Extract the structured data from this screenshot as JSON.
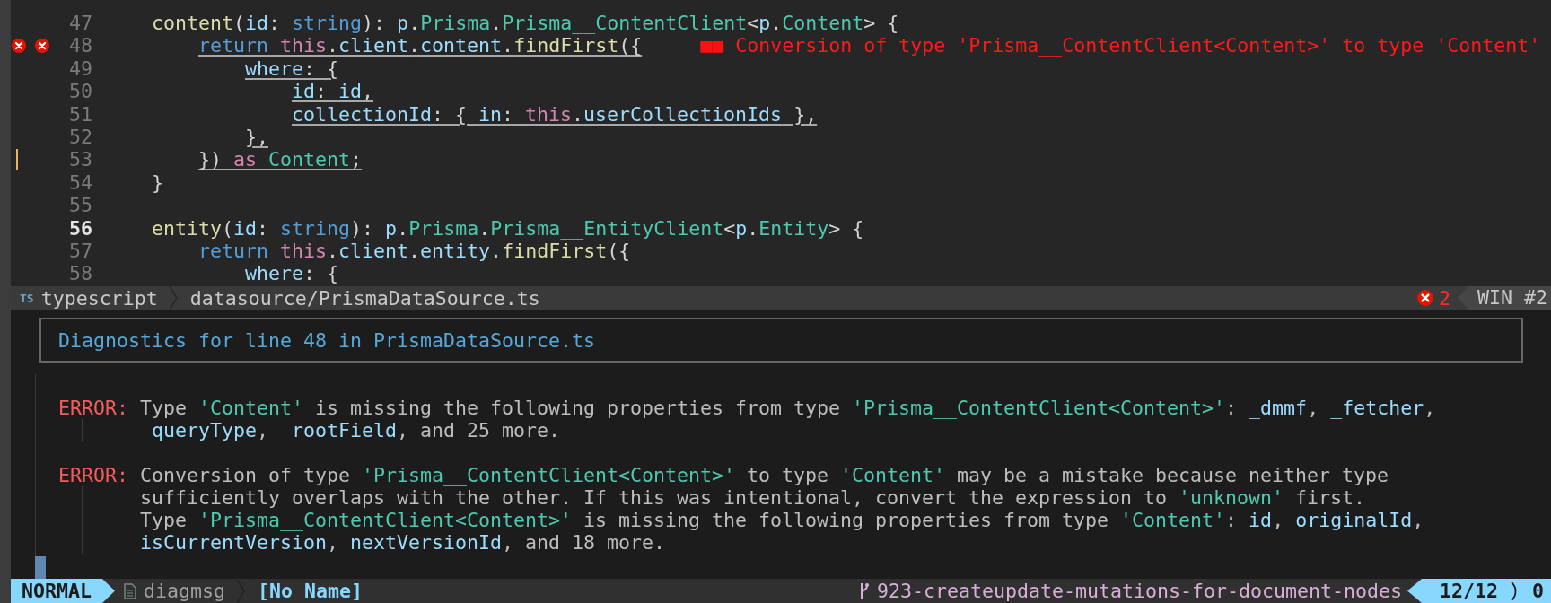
{
  "editor": {
    "lines": [
      {
        "number": "47",
        "current": false,
        "git_change": false,
        "underline": false,
        "tokens": [
          {
            "text": "    content",
            "kind": "function"
          },
          {
            "text": "(",
            "kind": "punctuation"
          },
          {
            "text": "id",
            "kind": "variable"
          },
          {
            "text": ": ",
            "kind": "punctuation"
          },
          {
            "text": "string",
            "kind": "keyword"
          },
          {
            "text": "): ",
            "kind": "punctuation"
          },
          {
            "text": "p",
            "kind": "variable"
          },
          {
            "text": ".",
            "kind": "punctuation"
          },
          {
            "text": "Prisma",
            "kind": "type"
          },
          {
            "text": ".",
            "kind": "punctuation"
          },
          {
            "text": "Prisma__ContentClient",
            "kind": "type"
          },
          {
            "text": "<",
            "kind": "punctuation"
          },
          {
            "text": "p",
            "kind": "variable"
          },
          {
            "text": ".",
            "kind": "punctuation"
          },
          {
            "text": "Content",
            "kind": "type"
          },
          {
            "text": "> {",
            "kind": "punctuation"
          }
        ]
      },
      {
        "number": "48",
        "current": false,
        "git_change": false,
        "underline": true,
        "signs": [
          {
            "kind": "error"
          },
          {
            "kind": "error"
          }
        ],
        "tokens": [
          {
            "text": "        return ",
            "kind": "keyword"
          },
          {
            "text": "this",
            "kind": "control"
          },
          {
            "text": ".",
            "kind": "punctuation"
          },
          {
            "text": "client",
            "kind": "variable"
          },
          {
            "text": ".",
            "kind": "punctuation"
          },
          {
            "text": "content",
            "kind": "variable"
          },
          {
            "text": ".",
            "kind": "punctuation"
          },
          {
            "text": "findFirst",
            "kind": "function"
          },
          {
            "text": "({",
            "kind": "punctuation"
          }
        ],
        "virtual_text": {
          "marker": "■■",
          "text": "Conversion of type 'Prisma__ContentClient<Content>' to type 'Content'"
        }
      },
      {
        "number": "49",
        "current": false,
        "git_change": false,
        "underline": true,
        "tokens": [
          {
            "text": "            where",
            "kind": "variable"
          },
          {
            "text": ": {",
            "kind": "punctuation"
          }
        ]
      },
      {
        "number": "50",
        "current": false,
        "git_change": false,
        "underline": true,
        "tokens": [
          {
            "text": "                id",
            "kind": "variable"
          },
          {
            "text": ": ",
            "kind": "punctuation"
          },
          {
            "text": "id",
            "kind": "variable"
          },
          {
            "text": ",",
            "kind": "punctuation"
          }
        ]
      },
      {
        "number": "51",
        "current": false,
        "git_change": false,
        "underline": true,
        "tokens": [
          {
            "text": "                collectionId",
            "kind": "variable"
          },
          {
            "text": ": { ",
            "kind": "punctuation"
          },
          {
            "text": "in",
            "kind": "variable"
          },
          {
            "text": ": ",
            "kind": "punctuation"
          },
          {
            "text": "this",
            "kind": "control"
          },
          {
            "text": ".",
            "kind": "punctuation"
          },
          {
            "text": "userCollectionIds",
            "kind": "variable"
          },
          {
            "text": " },",
            "kind": "punctuation"
          }
        ]
      },
      {
        "number": "52",
        "current": false,
        "git_change": false,
        "underline": true,
        "tokens": [
          {
            "text": "            },",
            "kind": "punctuation"
          }
        ]
      },
      {
        "number": "53",
        "current": false,
        "git_change": true,
        "underline": true,
        "tokens": [
          {
            "text": "        }) ",
            "kind": "punctuation"
          },
          {
            "text": "as ",
            "kind": "control"
          },
          {
            "text": "Content",
            "kind": "type"
          },
          {
            "text": ";",
            "kind": "punctuation"
          }
        ]
      },
      {
        "number": "54",
        "current": false,
        "git_change": false,
        "underline": false,
        "tokens": [
          {
            "text": "    }",
            "kind": "punctuation"
          }
        ]
      },
      {
        "number": "55",
        "current": false,
        "git_change": false
      },
      {
        "number": "56",
        "current": true,
        "git_change": false,
        "underline": false,
        "tokens": [
          {
            "text": "    entity",
            "kind": "function"
          },
          {
            "text": "(",
            "kind": "punctuation"
          },
          {
            "text": "id",
            "kind": "variable"
          },
          {
            "text": ": ",
            "kind": "punctuation"
          },
          {
            "text": "string",
            "kind": "keyword"
          },
          {
            "text": "): ",
            "kind": "punctuation"
          },
          {
            "text": "p",
            "kind": "variable"
          },
          {
            "text": ".",
            "kind": "punctuation"
          },
          {
            "text": "Prisma",
            "kind": "type"
          },
          {
            "text": ".",
            "kind": "punctuation"
          },
          {
            "text": "Prisma__EntityClient",
            "kind": "type"
          },
          {
            "text": "<",
            "kind": "punctuation"
          },
          {
            "text": "p",
            "kind": "variable"
          },
          {
            "text": ".",
            "kind": "punctuation"
          },
          {
            "text": "Entity",
            "kind": "type"
          },
          {
            "text": "> {",
            "kind": "punctuation"
          }
        ]
      },
      {
        "number": "57",
        "current": false,
        "git_change": false,
        "underline": false,
        "tokens": [
          {
            "text": "        return ",
            "kind": "keyword"
          },
          {
            "text": "this",
            "kind": "control"
          },
          {
            "text": ".",
            "kind": "punctuation"
          },
          {
            "text": "client",
            "kind": "variable"
          },
          {
            "text": ".",
            "kind": "punctuation"
          },
          {
            "text": "entity",
            "kind": "variable"
          },
          {
            "text": ".",
            "kind": "punctuation"
          },
          {
            "text": "findFirst",
            "kind": "function"
          },
          {
            "text": "({",
            "kind": "punctuation"
          }
        ]
      },
      {
        "number": "58",
        "current": false,
        "git_change": false,
        "underline": false,
        "tokens": [
          {
            "text": "            where",
            "kind": "variable"
          },
          {
            "text": ": {",
            "kind": "punctuation"
          }
        ]
      }
    ]
  },
  "status_line": {
    "filetype_icon": "TS",
    "filetype": "typescript",
    "path": "datasource/PrismaDataSource.ts",
    "error_count": "2",
    "window": "WIN #2"
  },
  "diagnostics": {
    "title": "Diagnostics for line 48 in PrismaDataSource.ts",
    "messages": [
      {
        "severity": "ERROR:",
        "kind": "error",
        "lines": [
          [
            {
              "text": "Type ",
              "kind": "text"
            },
            {
              "text": "'Content'",
              "kind": "string"
            },
            {
              "text": " is missing the following properties from type ",
              "kind": "text"
            },
            {
              "text": "'Prisma__ContentClient<Content>'",
              "kind": "string"
            },
            {
              "text": ": ",
              "kind": "text"
            },
            {
              "text": "_dmmf",
              "kind": "identifier"
            },
            {
              "text": ", ",
              "kind": "text"
            },
            {
              "text": "_fetcher",
              "kind": "identifier"
            },
            {
              "text": ",",
              "kind": "text"
            }
          ],
          [
            {
              "text": "_queryType",
              "kind": "identifier"
            },
            {
              "text": ", ",
              "kind": "text"
            },
            {
              "text": "_rootField",
              "kind": "identifier"
            },
            {
              "text": ", and 25 more.",
              "kind": "text"
            }
          ]
        ]
      },
      {
        "severity": "ERROR:",
        "kind": "error",
        "lines": [
          [
            {
              "text": "Conversion of type ",
              "kind": "text"
            },
            {
              "text": "'Prisma__ContentClient<Content>'",
              "kind": "string"
            },
            {
              "text": " to type ",
              "kind": "text"
            },
            {
              "text": "'Content'",
              "kind": "string"
            },
            {
              "text": " may be a mistake because neither type",
              "kind": "text"
            }
          ],
          [
            {
              "text": "sufficiently overlaps with the other. If this was intentional, convert the expression to ",
              "kind": "text"
            },
            {
              "text": "'unknown'",
              "kind": "string"
            },
            {
              "text": " first.",
              "kind": "text"
            }
          ],
          [
            {
              "text": "Type ",
              "kind": "text"
            },
            {
              "text": "'Prisma__ContentClient<Content>'",
              "kind": "string"
            },
            {
              "text": " is missing the following properties from type ",
              "kind": "text"
            },
            {
              "text": "'Content'",
              "kind": "string"
            },
            {
              "text": ": ",
              "kind": "text"
            },
            {
              "text": "id",
              "kind": "identifier"
            },
            {
              "text": ", ",
              "kind": "text"
            },
            {
              "text": "originalId",
              "kind": "identifier"
            },
            {
              "text": ",",
              "kind": "text"
            }
          ],
          [
            {
              "text": "isCurrentVersion",
              "kind": "identifier"
            },
            {
              "text": ", ",
              "kind": "text"
            },
            {
              "text": "nextVersionId",
              "kind": "identifier"
            },
            {
              "text": ", and 18 more.",
              "kind": "text"
            }
          ]
        ]
      }
    ]
  },
  "bottom_bar": {
    "mode": "NORMAL",
    "buffer_name": "diagmsg",
    "file": "[No Name]",
    "branch": "923-createupdate-mutations-for-document-nodes",
    "position": "12/12",
    "column": "0"
  }
}
